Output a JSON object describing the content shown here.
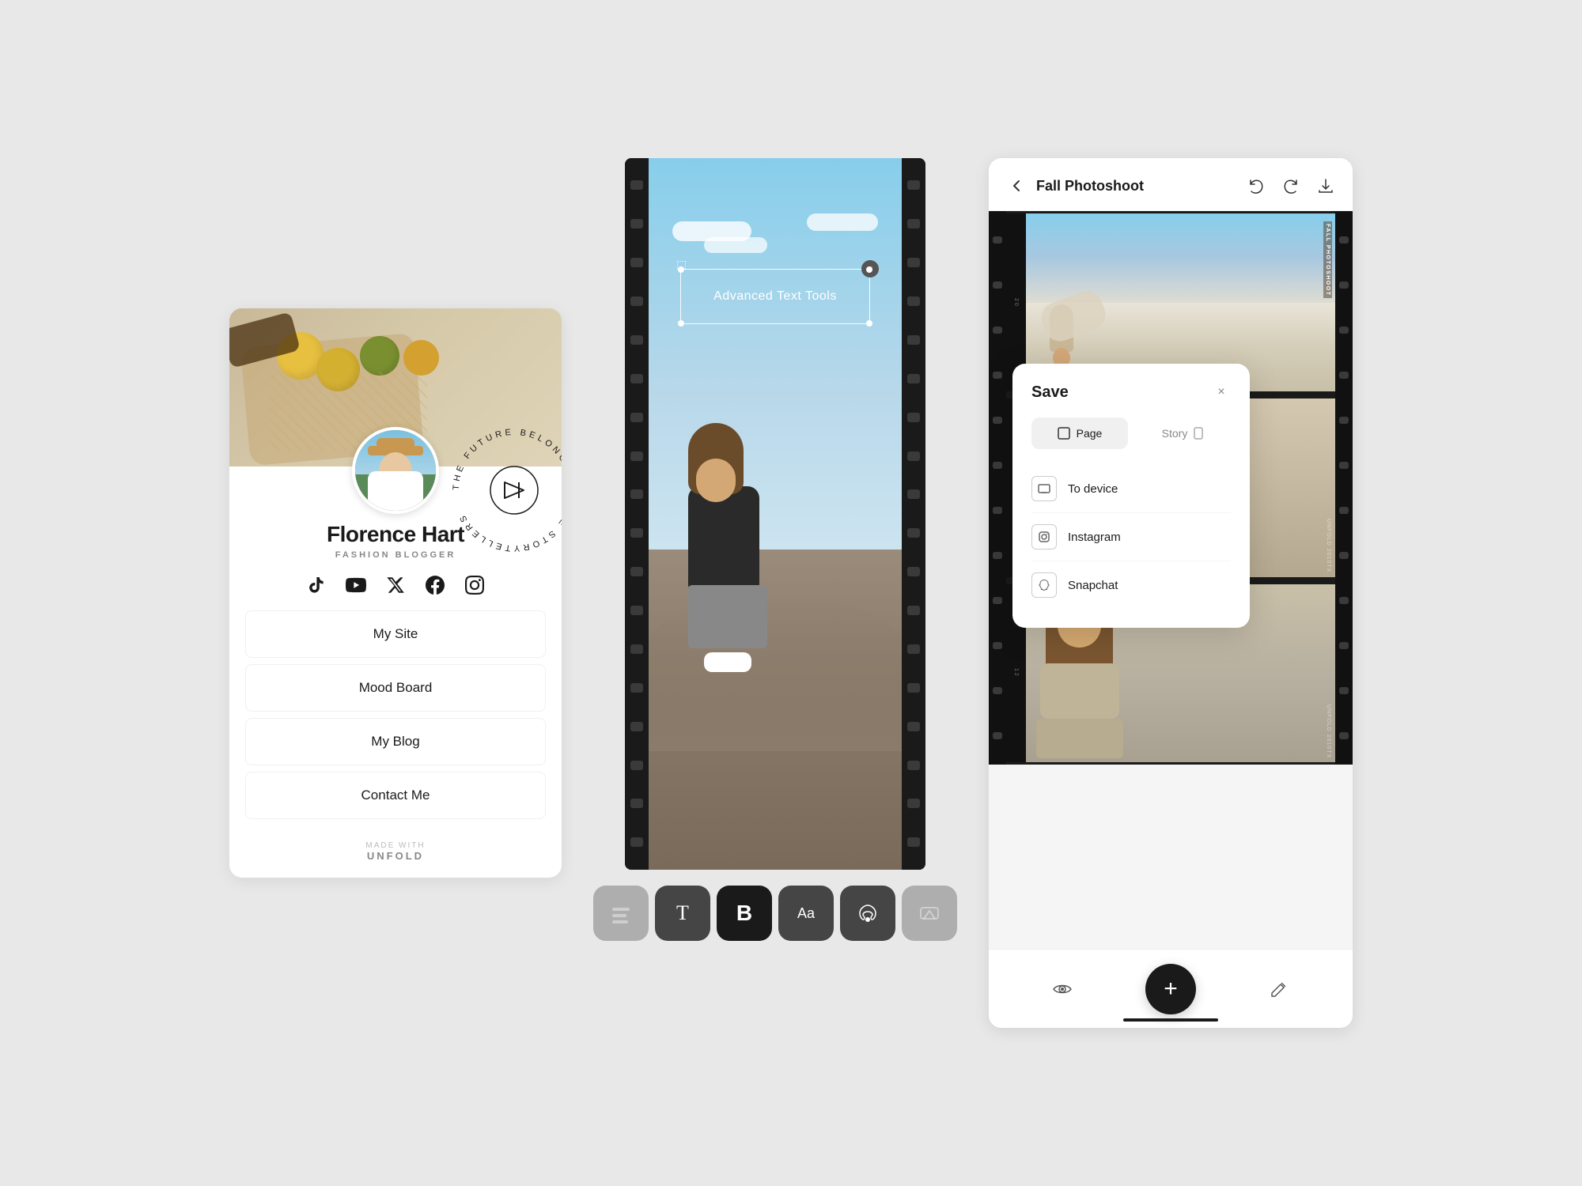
{
  "profile": {
    "name": "Florence Hart",
    "subtitle": "FASHION BLOGGER",
    "circular_text": "THE FUTURE BELONGS TO THE STORYTELLERS",
    "social_icons": [
      "tiktok",
      "youtube",
      "twitter",
      "facebook",
      "instagram"
    ],
    "nav_items": [
      "My Site",
      "Mood Board",
      "My Blog",
      "Contact Me"
    ],
    "made_with_label": "MADE WITH",
    "made_with_brand": "UNFOLD"
  },
  "editor": {
    "text_in_box": "Advanced Text Tools",
    "tools": [
      {
        "label": "T",
        "type": "text",
        "active": false
      },
      {
        "label": "B",
        "type": "bold",
        "active": true
      },
      {
        "label": "Aa",
        "type": "font",
        "active": false
      },
      {
        "label": "◈",
        "type": "color",
        "active": false
      }
    ]
  },
  "project": {
    "title": "Fall Photoshoot",
    "back_label": "←",
    "photoshoot_label": "FALL PHOTOSHOOT",
    "save_dialog": {
      "title": "Save",
      "close_icon": "×",
      "tabs": [
        {
          "label": "Page",
          "active": true,
          "icon": "🖼"
        },
        {
          "label": "Story",
          "active": false,
          "icon": "📱"
        }
      ],
      "options": [
        {
          "icon": "🖨",
          "label": "To device"
        },
        {
          "icon": "📷",
          "label": "Instagram"
        },
        {
          "icon": "👻",
          "label": "Snapchat"
        }
      ]
    },
    "bottom_toolbar": {
      "eye_icon": "👁",
      "add_icon": "+",
      "edit_icon": "✏"
    }
  },
  "colors": {
    "accent": "#1a1a1a",
    "bg": "#e8e8e8",
    "white": "#ffffff",
    "muted": "#888888"
  }
}
